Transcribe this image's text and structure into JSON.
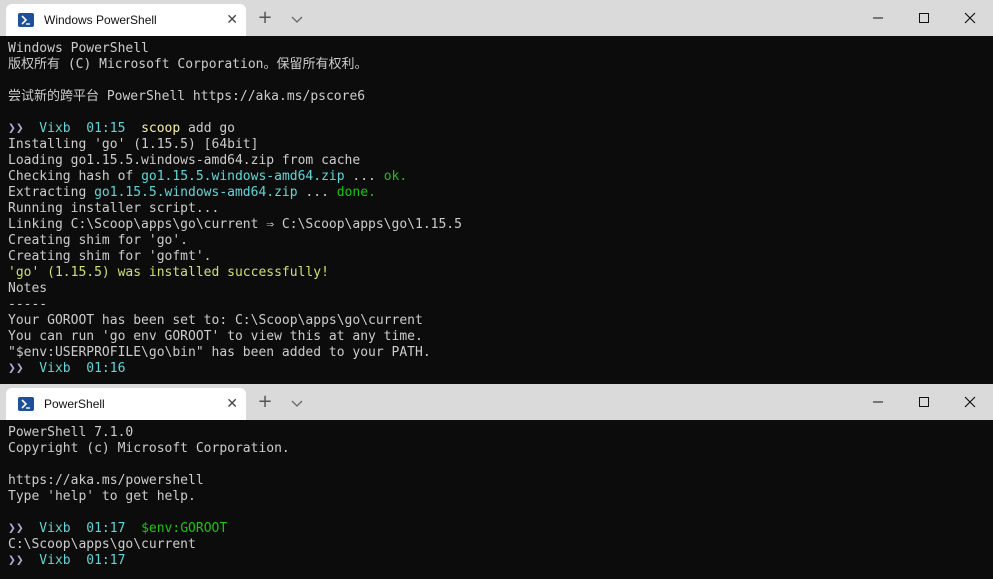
{
  "window1": {
    "tab_icon": "powershell-icon",
    "tab_title": "Windows PowerShell",
    "close_glyph": "✕",
    "newtab_glyph": "+",
    "lines": [
      {
        "segments": [
          {
            "t": "Windows PowerShell",
            "c": ""
          }
        ]
      },
      {
        "segments": [
          {
            "t": "版权所有 (C) Microsoft Corporation。保留所有权利。",
            "c": ""
          }
        ]
      },
      {
        "segments": [
          {
            "t": "",
            "c": ""
          }
        ]
      },
      {
        "segments": [
          {
            "t": "尝试新的跨平台 PowerShell https://aka.ms/pscore6",
            "c": ""
          }
        ]
      },
      {
        "segments": [
          {
            "t": "",
            "c": ""
          }
        ]
      },
      {
        "segments": [
          {
            "t": "❯❯ ",
            "c": "c-prompt"
          },
          {
            "t": " Vixb ",
            "c": "c-cyan"
          },
          {
            "t": " 01:15 ",
            "c": "c-cyan"
          },
          {
            "t": " scoop",
            "c": "c-yellow"
          },
          {
            "t": " add go",
            "c": ""
          }
        ]
      },
      {
        "segments": [
          {
            "t": "Installing 'go' (1.15.5) [64bit]",
            "c": ""
          }
        ]
      },
      {
        "segments": [
          {
            "t": "Loading go1.15.5.windows-amd64.zip from cache",
            "c": ""
          }
        ]
      },
      {
        "segments": [
          {
            "t": "Checking hash of ",
            "c": ""
          },
          {
            "t": "go1.15.5.windows-amd64.zip",
            "c": "c-cyan"
          },
          {
            "t": " ... ",
            "c": ""
          },
          {
            "t": "ok.",
            "c": "c-green"
          }
        ]
      },
      {
        "segments": [
          {
            "t": "Extracting ",
            "c": ""
          },
          {
            "t": "go1.15.5.windows-amd64.zip",
            "c": "c-cyan"
          },
          {
            "t": " ... ",
            "c": ""
          },
          {
            "t": "done.",
            "c": "c-green"
          }
        ]
      },
      {
        "segments": [
          {
            "t": "Running installer script...",
            "c": ""
          }
        ]
      },
      {
        "segments": [
          {
            "t": "Linking C:\\Scoop\\apps\\go\\current ⇒ C:\\Scoop\\apps\\go\\1.15.5",
            "c": ""
          }
        ]
      },
      {
        "segments": [
          {
            "t": "Creating shim for 'go'.",
            "c": ""
          }
        ]
      },
      {
        "segments": [
          {
            "t": "Creating shim for 'gofmt'.",
            "c": ""
          }
        ]
      },
      {
        "segments": [
          {
            "t": "'go' (1.15.5) was installed successfully!",
            "c": "c-ygreen"
          }
        ]
      },
      {
        "segments": [
          {
            "t": "Notes",
            "c": ""
          }
        ]
      },
      {
        "segments": [
          {
            "t": "-----",
            "c": ""
          }
        ]
      },
      {
        "segments": [
          {
            "t": "Your GOROOT has been set to: C:\\Scoop\\apps\\go\\current",
            "c": ""
          }
        ]
      },
      {
        "segments": [
          {
            "t": "You can run 'go env GOROOT' to view this at any time.",
            "c": ""
          }
        ]
      },
      {
        "segments": [
          {
            "t": "\"$env:USERPROFILE\\go\\bin\" has been added to your PATH.",
            "c": ""
          }
        ]
      },
      {
        "segments": [
          {
            "t": "❯❯ ",
            "c": "c-prompt"
          },
          {
            "t": " Vixb ",
            "c": "c-cyan"
          },
          {
            "t": " 01:16",
            "c": "c-cyan"
          }
        ]
      }
    ]
  },
  "window2": {
    "tab_icon": "powershell-icon",
    "tab_title": "PowerShell",
    "close_glyph": "✕",
    "newtab_glyph": "+",
    "lines": [
      {
        "segments": [
          {
            "t": "PowerShell 7.1.0",
            "c": ""
          }
        ]
      },
      {
        "segments": [
          {
            "t": "Copyright (c) Microsoft Corporation.",
            "c": ""
          }
        ]
      },
      {
        "segments": [
          {
            "t": "",
            "c": ""
          }
        ]
      },
      {
        "segments": [
          {
            "t": "https://aka.ms/powershell",
            "c": ""
          }
        ]
      },
      {
        "segments": [
          {
            "t": "Type 'help' to get help.",
            "c": ""
          }
        ]
      },
      {
        "segments": [
          {
            "t": "",
            "c": ""
          }
        ]
      },
      {
        "segments": [
          {
            "t": "❯❯ ",
            "c": "c-prompt"
          },
          {
            "t": " Vixb ",
            "c": "c-cyan"
          },
          {
            "t": " 01:17 ",
            "c": "c-cyan"
          },
          {
            "t": " $env:GOROOT",
            "c": "c-green"
          }
        ]
      },
      {
        "segments": [
          {
            "t": "C:\\Scoop\\apps\\go\\current",
            "c": ""
          }
        ]
      },
      {
        "segments": [
          {
            "t": "❯❯ ",
            "c": "c-prompt"
          },
          {
            "t": " Vixb ",
            "c": "c-cyan"
          },
          {
            "t": " 01:17",
            "c": "c-cyan"
          }
        ]
      }
    ]
  },
  "colors": {
    "terminal_bg": "#0c0c0c",
    "titlebar_bg": "#dadada",
    "tab_bg": "#ffffff",
    "text": "#cccccc",
    "cyan": "#61d6d6",
    "yellow": "#f9f1a5",
    "green": "#16c60c"
  }
}
